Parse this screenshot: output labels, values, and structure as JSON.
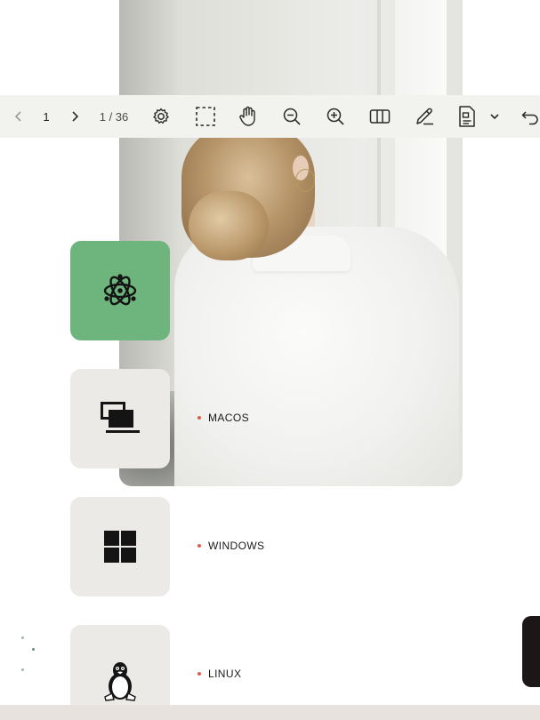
{
  "toolbar": {
    "current_page": "1",
    "page_count": "1 / 36",
    "icons": [
      "chevron-left-icon",
      "chevron-right-icon",
      "gear-icon",
      "select-area-icon",
      "hand-icon",
      "zoom-out-icon",
      "zoom-in-icon",
      "columns-icon",
      "pen-icon",
      "document-settings-icon",
      "chevron-down-icon",
      "undo-icon"
    ]
  },
  "platforms": [
    {
      "name": "",
      "icon": "electron-icon",
      "active": true
    },
    {
      "name": "MACOS",
      "icon": "monitor-stack-icon",
      "active": false
    },
    {
      "name": "WINDOWS",
      "icon": "windows-icon",
      "active": false
    },
    {
      "name": "LINUX",
      "icon": "linux-tux-icon",
      "active": false
    }
  ],
  "colors": {
    "active_tile": "#6db57d",
    "tile": "#ebeae6",
    "toolbar_bg": "#f2f2ee",
    "bullet": "#d9604c"
  }
}
